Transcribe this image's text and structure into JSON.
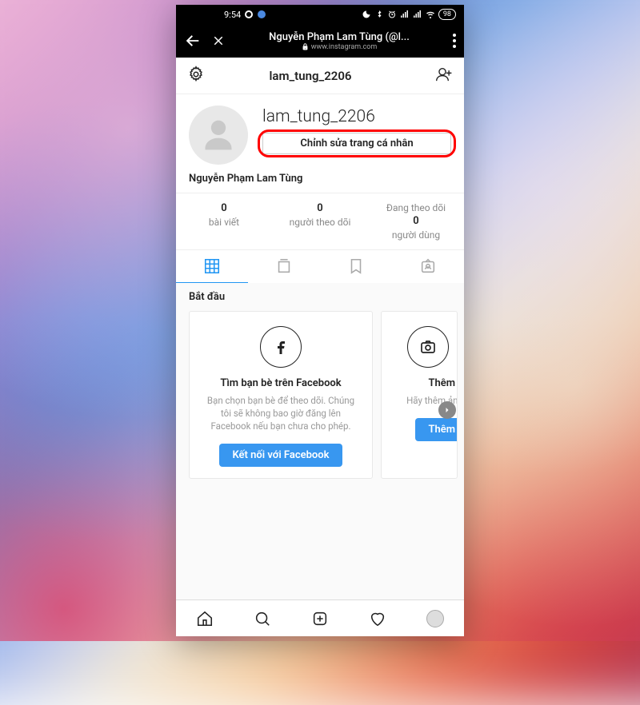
{
  "status": {
    "time": "9:54",
    "battery": "98"
  },
  "browser": {
    "title": "Nguyễn Phạm Lam Tùng (@l...",
    "url": "www.instagram.com"
  },
  "header": {
    "username": "lam_tung_2206"
  },
  "profile": {
    "username": "lam_tung_2206",
    "edit_label": "Chỉnh sửa trang cá nhân",
    "display_name": "Nguyễn Phạm Lam Tùng"
  },
  "stats": {
    "posts_count": "0",
    "posts_label": "bài viết",
    "followers_count": "0",
    "followers_label": "người theo dõi",
    "following_header": "Đang theo dõi",
    "following_count": "0",
    "following_unit": "người dùng"
  },
  "getting_started": {
    "title": "Bắt đầu",
    "card1_title": "Tìm bạn bè trên Facebook",
    "card1_desc": "Bạn chọn bạn bè để theo dõi. Chúng tôi sẽ không bao giờ đăng lên Facebook nếu bạn chưa cho phép.",
    "card1_btn": "Kết nối với Facebook",
    "card2_title": "Thêm ản",
    "card2_desc": "Hãy thêm ản đ biết đ",
    "card2_btn": "Thêm ản"
  }
}
